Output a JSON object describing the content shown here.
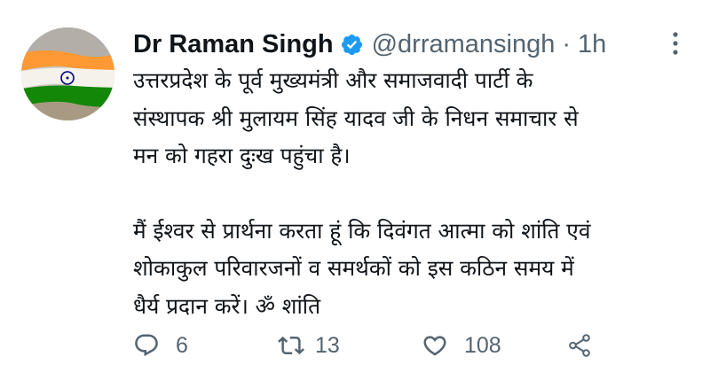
{
  "author": {
    "display_name": "Dr Raman Singh",
    "handle": "@drramansingh",
    "separator": "·",
    "time": "1h",
    "verified": true,
    "avatar": "indian-flag-avatar"
  },
  "tweet": {
    "paragraphs": [
      [
        "उत्तरप्रदेश के पूर्व मुख्यमंत्री और समाजवादी पार्टी के",
        "संस्थापक श्री मुलायम सिंह यादव जी के निधन समाचार से",
        "मन को गहरा दुःख पहुंचा है।"
      ],
      [
        "मैं ईश्वर से प्रार्थना करता हूं कि दिवंगत आत्मा को शांति एवं",
        "शोकाकुल परिवारजनों व समर्थकों को इस कठिन समय में",
        "धैर्य प्रदान करें। ॐ शांति"
      ]
    ]
  },
  "actions": {
    "reply": {
      "icon": "reply-icon",
      "count": "6"
    },
    "retweet": {
      "icon": "retweet-icon",
      "count": "13"
    },
    "like": {
      "icon": "heart-icon",
      "count": "108"
    },
    "share": {
      "icon": "share-icon"
    }
  },
  "colors": {
    "text": "#0f1419",
    "secondary": "#536471",
    "verified": "#1d9bf0",
    "saffron": "#ff9933",
    "green": "#138808",
    "chakra": "#000080"
  }
}
